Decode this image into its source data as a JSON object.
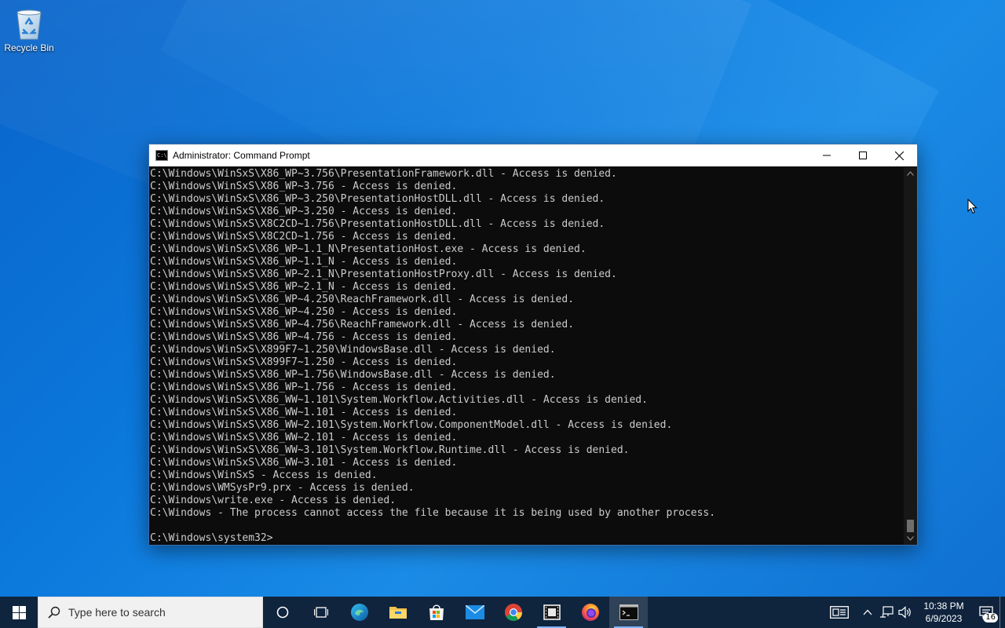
{
  "desktop": {
    "icons": [
      {
        "label": "Recycle Bin",
        "icon": "recycle-bin-icon"
      }
    ]
  },
  "window": {
    "title": "Administrator:  Command Prompt",
    "controls": [
      "minimize",
      "maximize",
      "close"
    ],
    "lines": [
      "C:\\Windows\\WinSxS\\X86_WP~3.756\\PresentationFramework.dll - Access is denied.",
      "C:\\Windows\\WinSxS\\X86_WP~3.756 - Access is denied.",
      "C:\\Windows\\WinSxS\\X86_WP~3.250\\PresentationHostDLL.dll - Access is denied.",
      "C:\\Windows\\WinSxS\\X86_WP~3.250 - Access is denied.",
      "C:\\Windows\\WinSxS\\X8C2CD~1.756\\PresentationHostDLL.dll - Access is denied.",
      "C:\\Windows\\WinSxS\\X8C2CD~1.756 - Access is denied.",
      "C:\\Windows\\WinSxS\\X86_WP~1.1_N\\PresentationHost.exe - Access is denied.",
      "C:\\Windows\\WinSxS\\X86_WP~1.1_N - Access is denied.",
      "C:\\Windows\\WinSxS\\X86_WP~2.1_N\\PresentationHostProxy.dll - Access is denied.",
      "C:\\Windows\\WinSxS\\X86_WP~2.1_N - Access is denied.",
      "C:\\Windows\\WinSxS\\X86_WP~4.250\\ReachFramework.dll - Access is denied.",
      "C:\\Windows\\WinSxS\\X86_WP~4.250 - Access is denied.",
      "C:\\Windows\\WinSxS\\X86_WP~4.756\\ReachFramework.dll - Access is denied.",
      "C:\\Windows\\WinSxS\\X86_WP~4.756 - Access is denied.",
      "C:\\Windows\\WinSxS\\X899F7~1.250\\WindowsBase.dll - Access is denied.",
      "C:\\Windows\\WinSxS\\X899F7~1.250 - Access is denied.",
      "C:\\Windows\\WinSxS\\X86_WP~1.756\\WindowsBase.dll - Access is denied.",
      "C:\\Windows\\WinSxS\\X86_WP~1.756 - Access is denied.",
      "C:\\Windows\\WinSxS\\X86_WW~1.101\\System.Workflow.Activities.dll - Access is denied.",
      "C:\\Windows\\WinSxS\\X86_WW~1.101 - Access is denied.",
      "C:\\Windows\\WinSxS\\X86_WW~2.101\\System.Workflow.ComponentModel.dll - Access is denied.",
      "C:\\Windows\\WinSxS\\X86_WW~2.101 - Access is denied.",
      "C:\\Windows\\WinSxS\\X86_WW~3.101\\System.Workflow.Runtime.dll - Access is denied.",
      "C:\\Windows\\WinSxS\\X86_WW~3.101 - Access is denied.",
      "C:\\Windows\\WinSxS - Access is denied.",
      "C:\\Windows\\WMSysPr9.prx - Access is denied.",
      "C:\\Windows\\write.exe - Access is denied.",
      "C:\\Windows - The process cannot access the file because it is being used by another process.",
      "",
      "C:\\Windows\\system32>"
    ],
    "scroll_position": 0.98
  },
  "taskbar": {
    "search_placeholder": "Type here to search",
    "apps": [
      {
        "name": "task-view",
        "icon": "task-view-icon"
      },
      {
        "name": "cortana",
        "icon": "cortana-circle-icon"
      },
      {
        "name": "edge",
        "icon": "edge-icon"
      },
      {
        "name": "file-explorer",
        "icon": "folder-icon"
      },
      {
        "name": "store",
        "icon": "store-icon"
      },
      {
        "name": "mail",
        "icon": "mail-icon"
      },
      {
        "name": "chrome",
        "icon": "chrome-icon"
      },
      {
        "name": "media",
        "icon": "film-icon"
      },
      {
        "name": "firefox",
        "icon": "firefox-icon"
      },
      {
        "name": "command-prompt",
        "icon": "cmd-icon"
      }
    ],
    "time": "10:38 PM",
    "date": "6/9/2023",
    "notification_count": "16"
  }
}
